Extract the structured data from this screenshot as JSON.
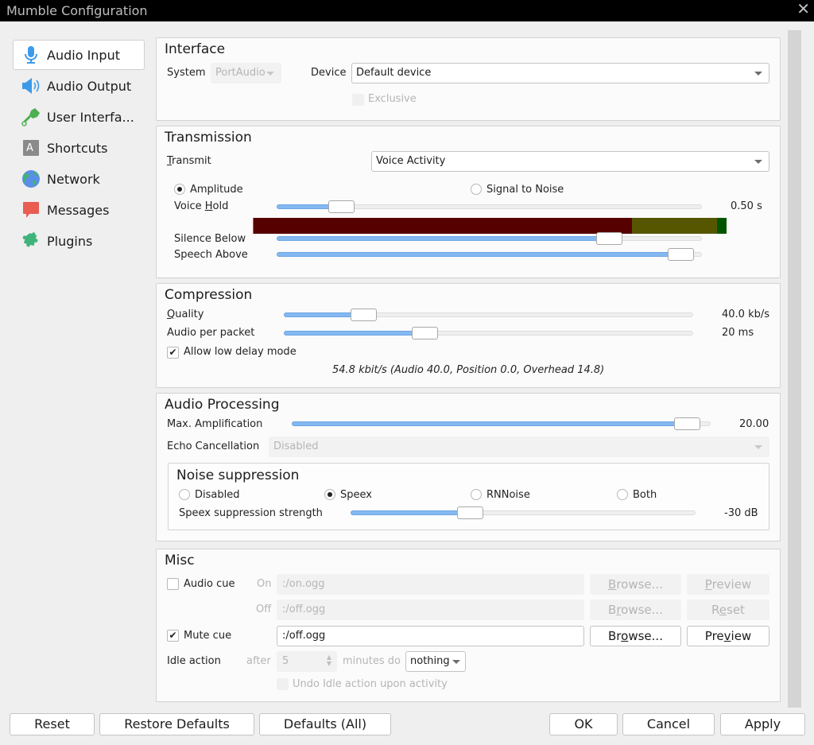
{
  "window": {
    "title": "Mumble Configuration",
    "close_icon": "close-icon"
  },
  "sidebar": {
    "items": [
      {
        "label": "Audio Input",
        "icon": "microphone-icon",
        "active": true
      },
      {
        "label": "Audio Output",
        "icon": "speaker-icon",
        "active": false
      },
      {
        "label": "User Interfa...",
        "icon": "paintbrush-icon",
        "active": false
      },
      {
        "label": "Shortcuts",
        "icon": "keyboard-key-icon",
        "active": false
      },
      {
        "label": "Network",
        "icon": "globe-icon",
        "active": false
      },
      {
        "label": "Messages",
        "icon": "speech-bubble-icon",
        "active": false
      },
      {
        "label": "Plugins",
        "icon": "puzzle-icon",
        "active": false
      }
    ]
  },
  "interface": {
    "title": "Interface",
    "system_label": "System",
    "system_value": "PortAudio",
    "device_label": "Device",
    "device_value": "Default device",
    "exclusive_label": "Exclusive",
    "exclusive_checked": false
  },
  "transmission": {
    "title": "Transmission",
    "transmit_label": "Transmit",
    "transmit_value": "Voice Activity",
    "amplitude_label": "Amplitude",
    "amplitude_selected": true,
    "snr_label": "Signal to Noise",
    "snr_selected": false,
    "voice_hold_label": "Voice Hold",
    "voice_hold_value": "0.50 s",
    "voice_hold_fraction": 0.13,
    "level_meter": {
      "red_fraction": 0.8,
      "yellow_fraction": 0.98,
      "green_fraction": 1.0,
      "colors": {
        "red": "#560000",
        "yellow": "#565600",
        "green": "#005600"
      }
    },
    "silence_below_label": "Silence Below",
    "silence_below_fraction": 0.8,
    "speech_above_label": "Speech Above",
    "speech_above_fraction": 0.98
  },
  "compression": {
    "title": "Compression",
    "quality_label": "Quality",
    "quality_value": "40.0 kb/s",
    "quality_fraction": 0.174,
    "audio_per_packet_label": "Audio per packet",
    "audio_per_packet_value": "20 ms",
    "audio_per_packet_fraction": 0.334,
    "low_delay_label": "Allow low delay mode",
    "low_delay_checked": true,
    "bitrate_summary": "54.8 kbit/s (Audio 40.0, Position 0.0, Overhead 14.8)"
  },
  "audio_processing": {
    "title": "Audio Processing",
    "max_amp_label": "Max. Amplification",
    "max_amp_value": "20.00",
    "max_amp_fraction": 0.974,
    "echo_label": "Echo Cancellation",
    "echo_value": "Disabled",
    "noise": {
      "title": "Noise suppression",
      "options": [
        {
          "label": "Disabled",
          "selected": false
        },
        {
          "label": "Speex",
          "selected": true
        },
        {
          "label": "RNNoise",
          "selected": false
        },
        {
          "label": "Both",
          "selected": false
        }
      ],
      "speex_strength_label": "Speex suppression strength",
      "speex_strength_value": "-30 dB",
      "speex_strength_fraction": 0.334
    }
  },
  "misc": {
    "title": "Misc",
    "audio_cue_label": "Audio cue",
    "audio_cue_checked": false,
    "on_label": "On",
    "on_value": ":/on.ogg",
    "off_label": "Off",
    "off_value": ":/off.ogg",
    "browse_label": "Browse...",
    "preview_label": "Preview",
    "reset_label": "Reset",
    "mute_cue_label": "Mute cue",
    "mute_cue_checked": true,
    "mute_cue_value": ":/off.ogg",
    "idle_action_label": "Idle action",
    "after_label": "after",
    "idle_minutes": "5",
    "minutes_do_label": "minutes do",
    "idle_action_value": "nothing",
    "undo_idle_label": "Undo Idle action upon activity",
    "undo_idle_checked": false
  },
  "footer": {
    "reset": "Reset",
    "restore_defaults": "Restore Defaults",
    "defaults_all": "Defaults (All)",
    "ok": "OK",
    "cancel": "Cancel",
    "apply": "Apply"
  }
}
